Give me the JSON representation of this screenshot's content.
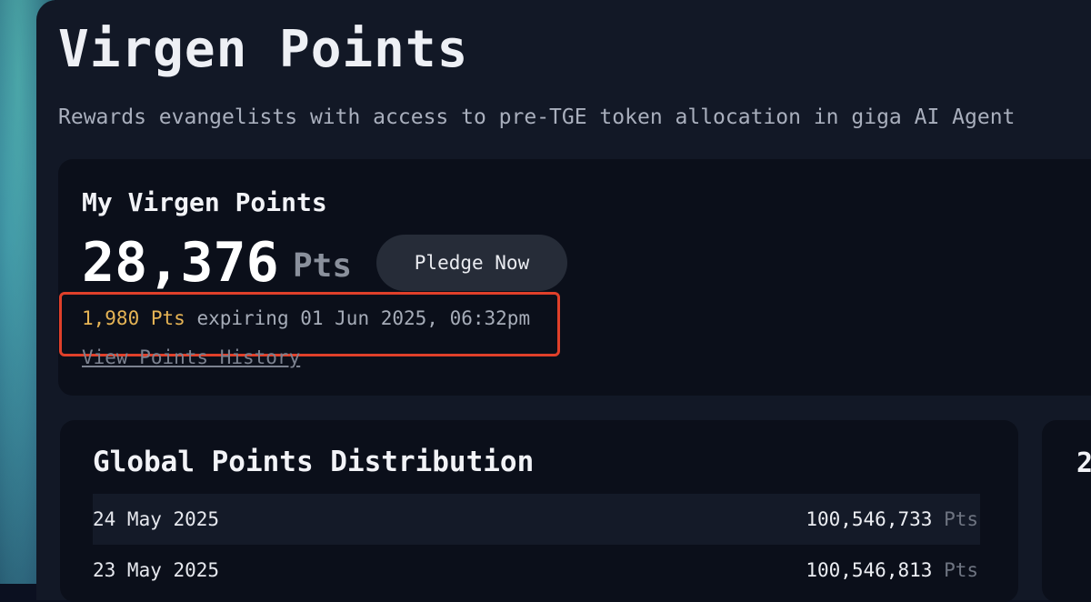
{
  "header": {
    "title": "Virgen Points",
    "subtitle": "Rewards evangelists with access to pre-TGE token allocation in giga AI Agent"
  },
  "my_points": {
    "title": "My Virgen Points",
    "total": "28,376",
    "unit": "Pts",
    "pledge_label": "Pledge Now",
    "expiring_points": "1,980 Pts",
    "expiring_text": " expiring 01 Jun 2025, 06:32pm",
    "history_link": "View Points History"
  },
  "global_distribution": {
    "title": "Global Points Distribution",
    "rows": [
      {
        "date": "24 May 2025",
        "value": "100,546,733",
        "unit": "Pts"
      },
      {
        "date": "23 May 2025",
        "value": "100,546,813",
        "unit": "Pts"
      }
    ]
  },
  "right_card": {
    "peek_text": "2"
  },
  "colors": {
    "accent_gold": "#e6b455",
    "highlight_red": "#e0402a",
    "panel_bg": "#121826",
    "card_bg": "#0b0f1a"
  }
}
